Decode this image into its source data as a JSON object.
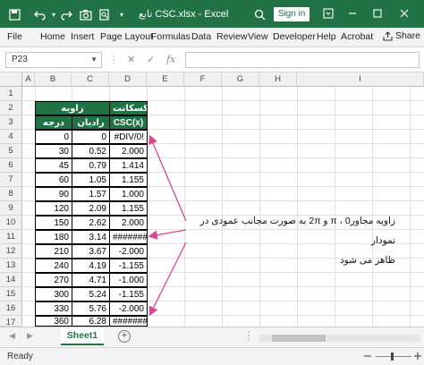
{
  "titlebar": {
    "title": "تابع CSC.xlsx  -  Excel",
    "signin": "Sign in",
    "accent": "#217346"
  },
  "ribbon": {
    "tabs": [
      "File",
      "Home",
      "Insert",
      "Page Layout",
      "Formulas",
      "Data",
      "Review",
      "View",
      "Developer",
      "Help",
      "Acrobat"
    ],
    "share": "Share"
  },
  "formula_bar": {
    "name_box": "P23",
    "fx": "fx",
    "value": ""
  },
  "grid": {
    "columns": [
      "A",
      "B",
      "C",
      "D",
      "E",
      "F",
      "G",
      "H",
      "I"
    ],
    "rows": [
      "1",
      "2",
      "3",
      "4",
      "5",
      "6",
      "7",
      "8",
      "9",
      "10",
      "11",
      "12",
      "13",
      "14",
      "15",
      "16",
      "17"
    ]
  },
  "table": {
    "header_angle": "زاویه",
    "header_cosecant": "کسکانت",
    "sub_degree": "درجه",
    "sub_radian": "رادیان",
    "sub_csc": "CSC(x)",
    "rows": [
      {
        "deg": "0",
        "rad": "0",
        "csc": "#DIV/0!"
      },
      {
        "deg": "30",
        "rad": "0.52",
        "csc": "2.000"
      },
      {
        "deg": "45",
        "rad": "0.79",
        "csc": "1.414"
      },
      {
        "deg": "60",
        "rad": "1.05",
        "csc": "1.155"
      },
      {
        "deg": "90",
        "rad": "1.57",
        "csc": "1.000"
      },
      {
        "deg": "120",
        "rad": "2.09",
        "csc": "1.155"
      },
      {
        "deg": "150",
        "rad": "2.62",
        "csc": "2.000"
      },
      {
        "deg": "180",
        "rad": "3.14",
        "csc": "#######"
      },
      {
        "deg": "210",
        "rad": "3.67",
        "csc": "-2.000"
      },
      {
        "deg": "240",
        "rad": "4.19",
        "csc": "-1.155"
      },
      {
        "deg": "270",
        "rad": "4.71",
        "csc": "-1.000"
      },
      {
        "deg": "300",
        "rad": "5.24",
        "csc": "-1.155"
      },
      {
        "deg": "330",
        "rad": "5.76",
        "csc": "-2.000"
      },
      {
        "deg": "360",
        "rad": "6.28",
        "csc": "#######"
      }
    ]
  },
  "annotation": {
    "line1": "زاویه مجاور0 ، π و 2π به صورت مجانب عمودی در نمودار",
    "line2": "ظاهر می شود",
    "arrow_color": "#e0448f"
  },
  "sheets": {
    "tabs": [
      "Sheet1"
    ],
    "add": "+"
  },
  "status": {
    "text": "Ready"
  }
}
